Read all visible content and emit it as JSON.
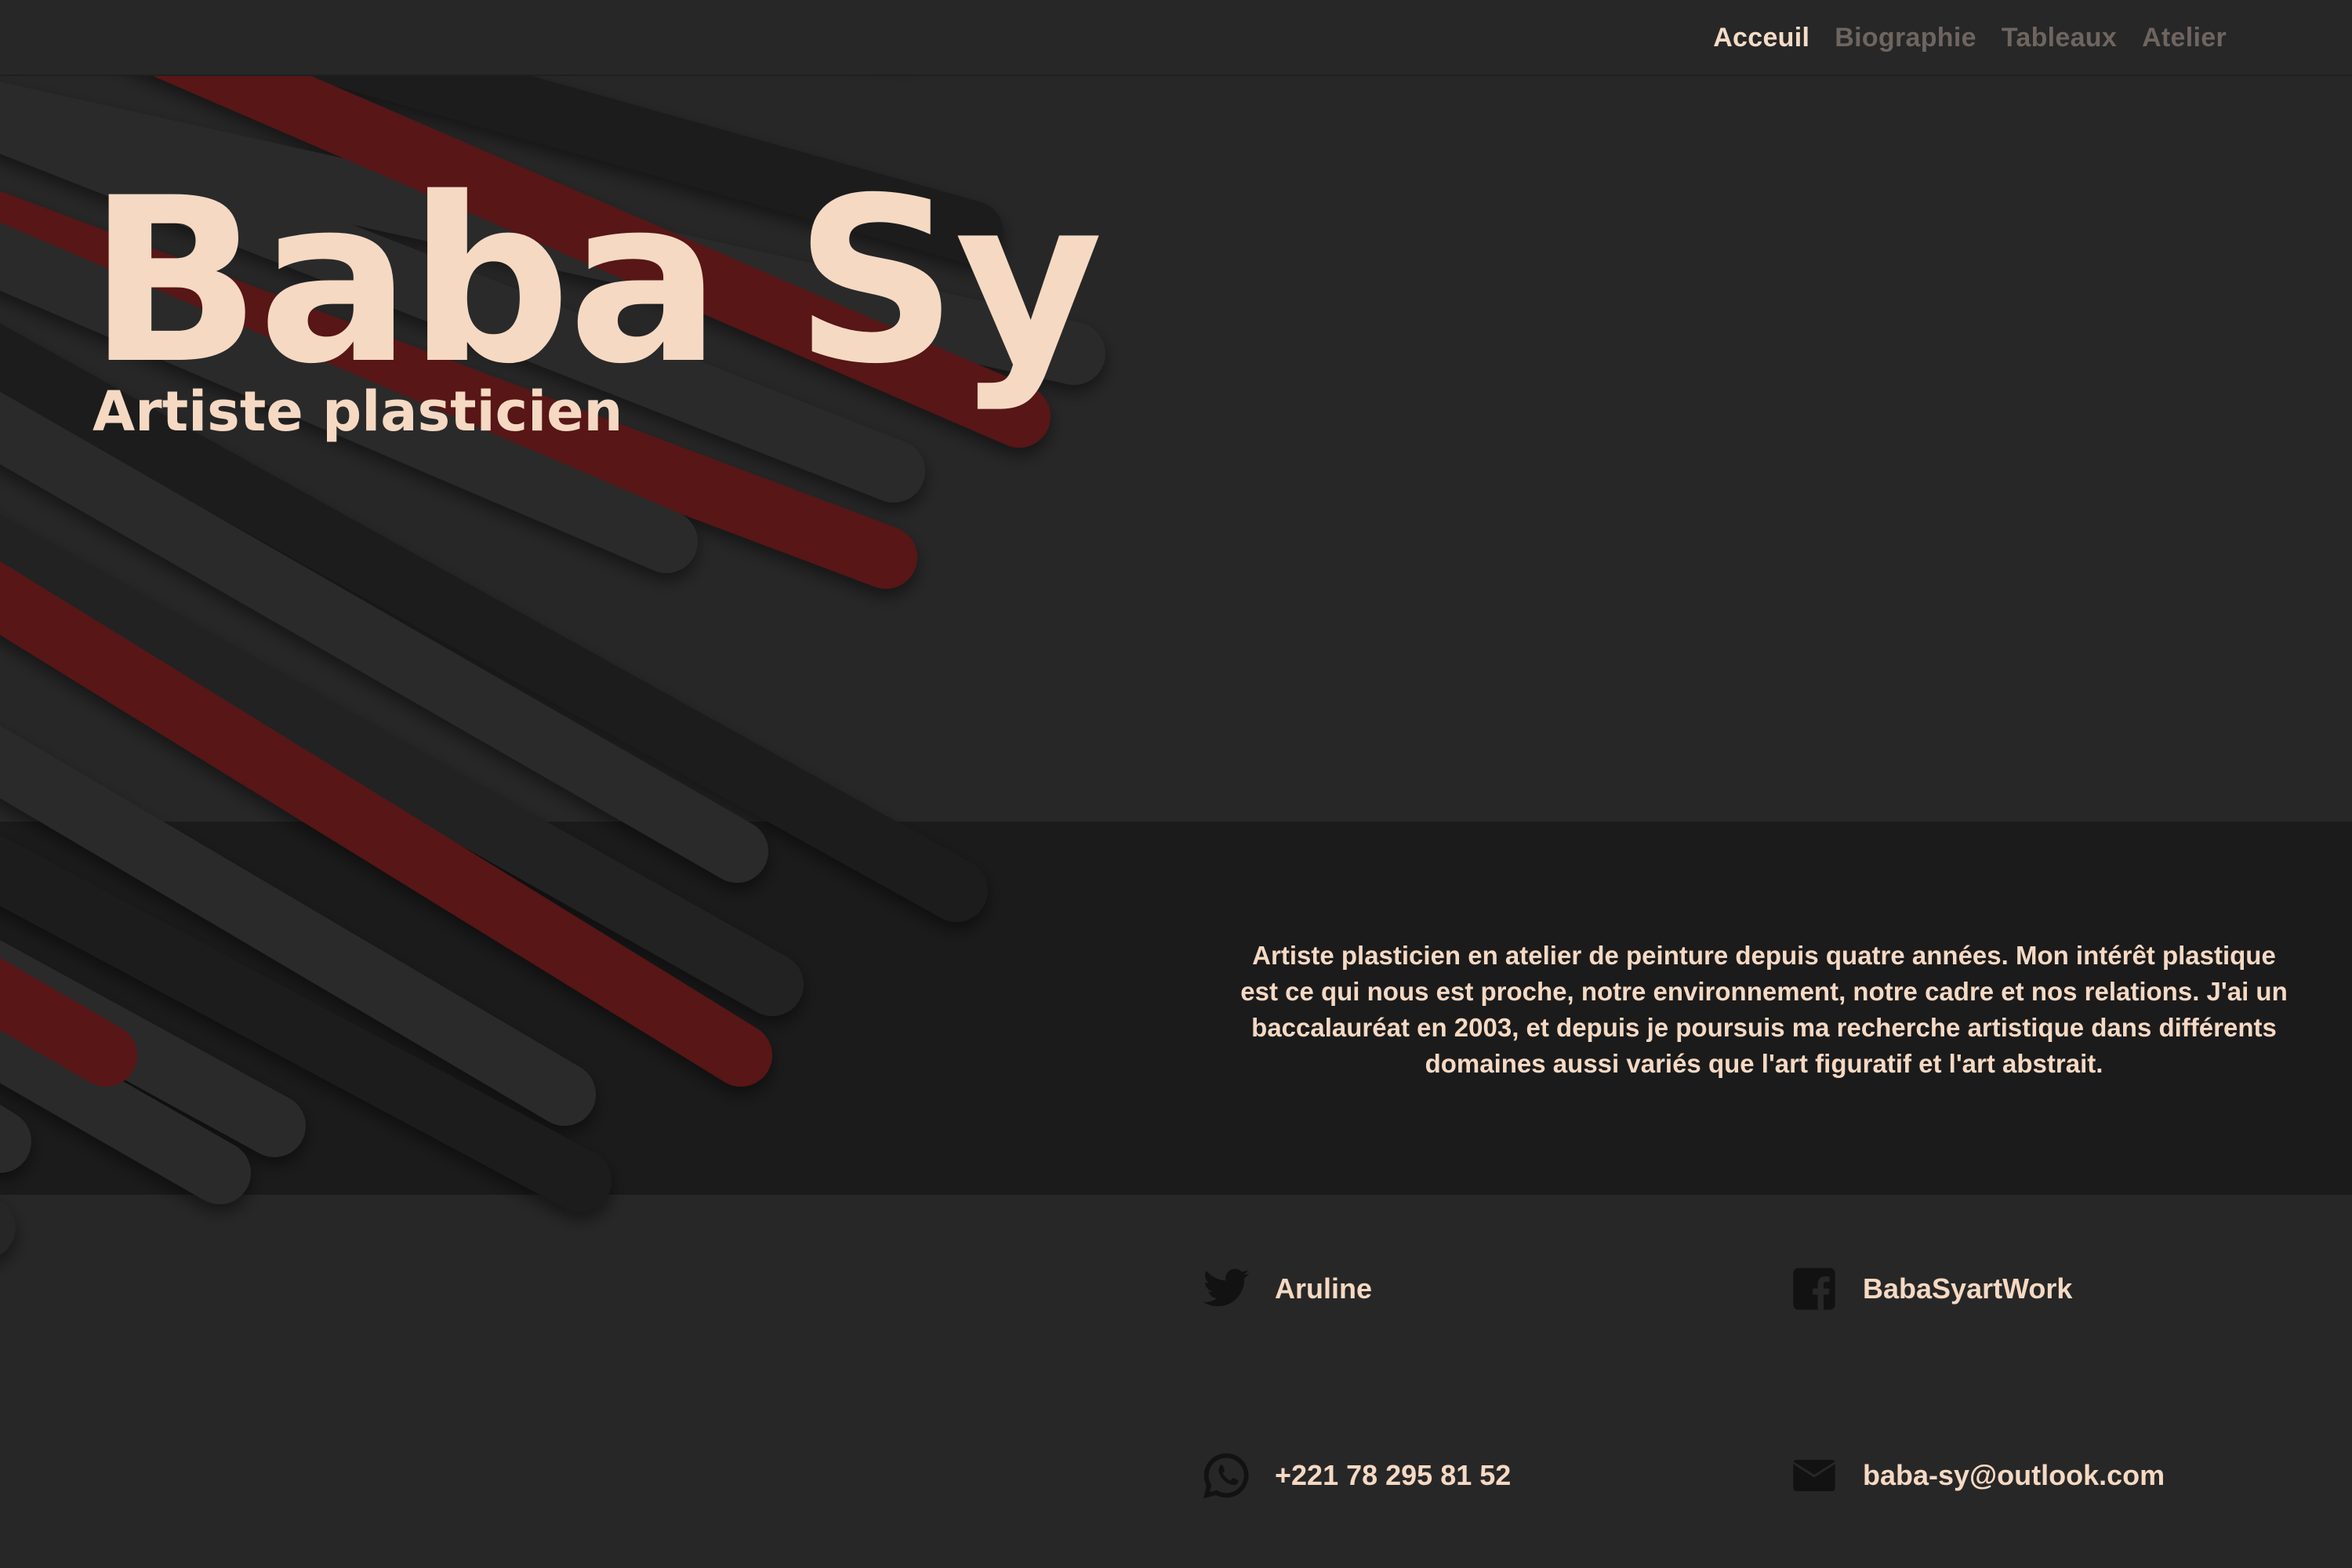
{
  "nav": {
    "items": [
      {
        "label": "Acceuil",
        "active": true
      },
      {
        "label": "Biographie",
        "active": false
      },
      {
        "label": "Tableaux",
        "active": false
      },
      {
        "label": "Atelier",
        "active": false
      }
    ]
  },
  "hero": {
    "name": "Baba Sy",
    "subtitle": "Artiste plasticien"
  },
  "bio": {
    "text": "Artiste plasticien en atelier de peinture depuis quatre années. Mon intérêt plastique est ce qui nous est proche, notre environnement, notre cadre et nos relations. J'ai un baccalauréat en 2003, et depuis je poursuis ma recherche artistique dans différents domaines aussi variés que l'art figuratif et l'art abstrait."
  },
  "contacts": {
    "twitter": {
      "label": "Aruline",
      "icon": "twitter-icon"
    },
    "facebook": {
      "label": "BabaSyartWork",
      "icon": "facebook-icon"
    },
    "whatsapp": {
      "label": "+221 78 295 81 52",
      "icon": "whatsapp-icon"
    },
    "email": {
      "label": "baba-sy@outlook.com",
      "icon": "mail-icon"
    }
  },
  "colors": {
    "background": "#272727",
    "band": "#1b1b1b",
    "accent_text": "#f5d9c3",
    "stripe_red": "#581818",
    "stripe_dark": "#1e1e1e",
    "nav_inactive": "#6e6560"
  }
}
